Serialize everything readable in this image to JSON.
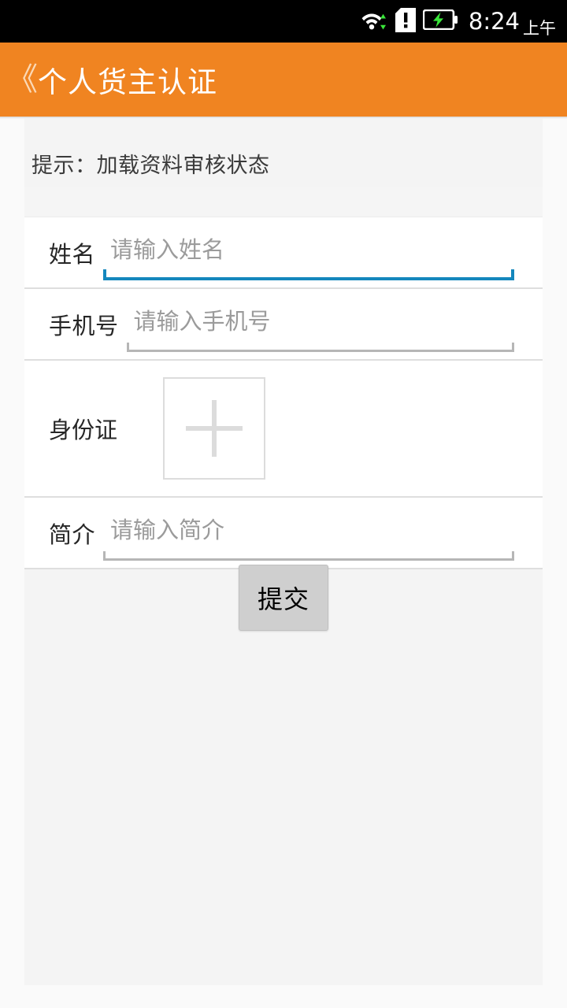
{
  "status_bar": {
    "time": "8:24",
    "am_pm": "上午",
    "icons": [
      "wifi-icon",
      "sim-warning-icon",
      "battery-charging-icon"
    ]
  },
  "app_bar": {
    "back_label": "《",
    "title": "个人货主认证",
    "background_color": "#f08421",
    "title_color": "#ffffff"
  },
  "hint": {
    "text": "提示：加载资料审核状态"
  },
  "form": {
    "fields": [
      {
        "key": "name",
        "label": "姓名",
        "placeholder": "请输入姓名",
        "value": "",
        "focused": true
      },
      {
        "key": "phone",
        "label": "手机号",
        "placeholder": "请输入手机号",
        "value": "",
        "focused": false
      },
      {
        "key": "intro",
        "label": "简介",
        "placeholder": "请输入简介",
        "value": "",
        "focused": false
      }
    ],
    "id_card": {
      "label": "身份证",
      "upload_icon": "plus-icon"
    }
  },
  "submit": {
    "label": "提交"
  },
  "colors": {
    "accent": "#f08421",
    "focus_underline": "#1487bd",
    "idle_underline": "#b6b6b6",
    "page_background": "#f4f4f4",
    "card_background": "#ffffff",
    "divider": "#dedede",
    "placeholder_text": "#9b9b9b",
    "button_background": "#cfcfcf"
  }
}
